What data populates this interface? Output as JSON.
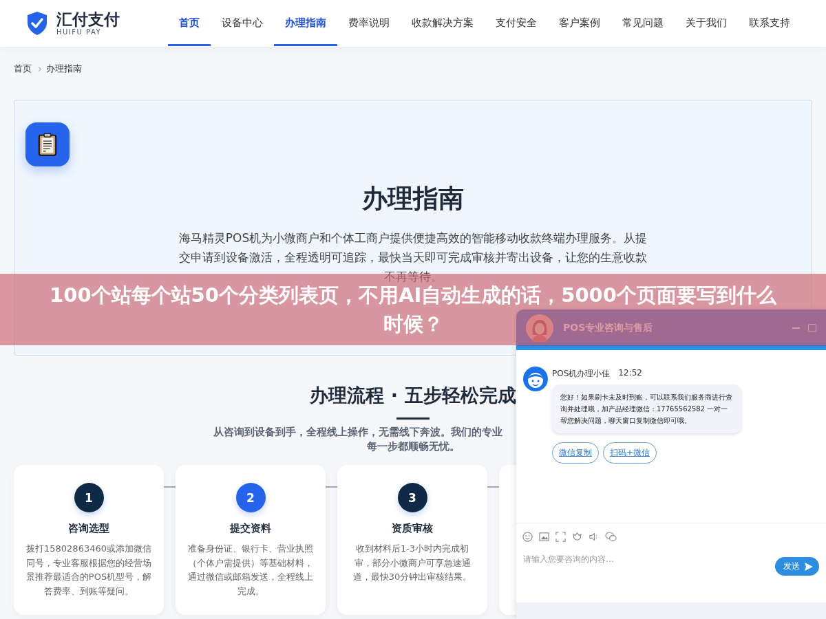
{
  "header": {
    "logo_title": "汇付支付",
    "logo_subtitle": "HUIFU PAY",
    "nav": [
      {
        "label": "首页",
        "selected": true
      },
      {
        "label": "设备中心",
        "selected": false
      },
      {
        "label": "办理指南",
        "selected": true
      },
      {
        "label": "费率说明",
        "selected": false
      },
      {
        "label": "收款解决方案",
        "selected": false
      },
      {
        "label": "支付安全",
        "selected": false
      },
      {
        "label": "客户案例",
        "selected": false
      },
      {
        "label": "常见问题",
        "selected": false
      },
      {
        "label": "关于我们",
        "selected": false
      },
      {
        "label": "联系支持",
        "selected": false
      }
    ]
  },
  "breadcrumb": [
    "首页",
    "办理指南"
  ],
  "hero": {
    "title": "办理指南",
    "description": "海马精灵POS机为小微商户和个体工商户提供便捷高效的智能移动收款终端办理服务。从提交申请到设备激活，全程透明可追踪，最快当天即可完成审核并寄出设备，让您的生意收款不再等待。"
  },
  "process": {
    "title": "办理流程 · 五步轻松完成",
    "subtitle": "从咨询到设备到手，全程线上操作，无需线下奔波。我们的专业",
    "subtitle_line_2": "每一步都顺畅无忧。",
    "steps": [
      {
        "number": "1",
        "title": "咨询选型",
        "text": "拨打15802863460或添加微信同号，专业客服根据您的经营场景推荐最适合的POS机型号，解答费率、到账等疑问。",
        "selected": false
      },
      {
        "number": "2",
        "title": "提交资料",
        "text": "准备身份证、银行卡、营业执照（个体户需提供）等基础材料，通过微信或邮箱发送，全程线上完成。",
        "selected": true
      },
      {
        "number": "3",
        "title": "资质审核",
        "text": "收到材料后1-3小时内完成初审，部分小微商户可享急速通道，最快30分钟出审核结果。",
        "selected": false
      }
    ]
  },
  "overlay_banner": {
    "text": "100个站每个站50个分类列表页，不用AI自动生成的话，5000个页面要写到什么时候？"
  },
  "chat": {
    "title": "POS专业咨询与售后",
    "messages": [
      {
        "sender": "POS机办理小佳",
        "time": "12:52",
        "text": "您好！如果刷卡未及时到账，可以联系我们服务商进行查询并处理哦，加产品经理微信：17765562582 一对一帮您解决问题，聊天窗口复制微信即可哦。"
      }
    ],
    "quick_replies": [
      "微信复制",
      "扫码+微信"
    ],
    "input": {
      "placeholder": "请输入您要咨询的内容..."
    },
    "send_button": "发送"
  }
}
